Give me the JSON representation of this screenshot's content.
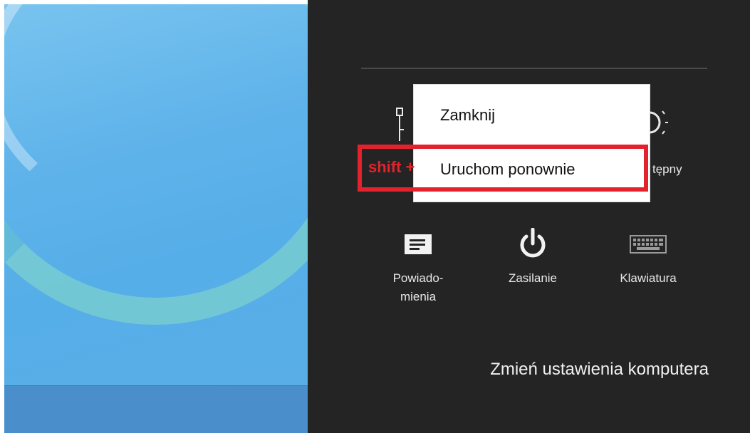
{
  "popup": {
    "items": [
      "Zamknij",
      "Uruchom ponownie"
    ]
  },
  "annotation": {
    "shift_text": "shift +"
  },
  "partial_tile_label": "tępny",
  "tiles": [
    {
      "label": "Powiado-\nmienia",
      "icon": "notifications-icon"
    },
    {
      "label": "Zasilanie",
      "icon": "power-icon"
    },
    {
      "label": "Klawiatura",
      "icon": "keyboard-icon"
    }
  ],
  "settings_link": "Zmień ustawienia komputera",
  "colors": {
    "charms_bg": "#242424",
    "highlight": "#e3222e",
    "desktop_blue": "#5fb3ea"
  }
}
